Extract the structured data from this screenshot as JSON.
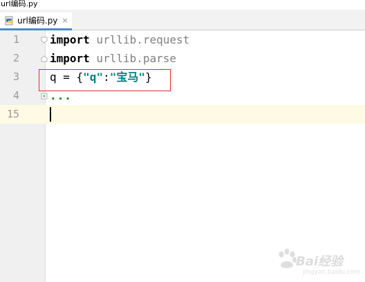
{
  "window": {
    "title": "url编码.py"
  },
  "tab": {
    "label": "url编码.py",
    "close_glyph": "×"
  },
  "editor": {
    "lines": [
      {
        "number": "1",
        "import_kw": "import",
        "module": " urllib.request"
      },
      {
        "number": "2",
        "import_kw": "import",
        "module": " urllib.parse"
      },
      {
        "number": "3",
        "var": "q",
        "eq": " = {",
        "key": "\"q\"",
        "colon": ":",
        "value": "\"宝马\"",
        "close": "}"
      },
      {
        "number": "4",
        "folded": "..."
      },
      {
        "number": "15"
      }
    ]
  },
  "watermark": {
    "brand": "Bai经验",
    "url": "jingyan.baidu.com"
  },
  "colors": {
    "keyword": "#000080",
    "string": "#008080",
    "current_line": "#fffae3",
    "highlight_border": "#e8292c",
    "tab_underline": "#4a88c7"
  }
}
